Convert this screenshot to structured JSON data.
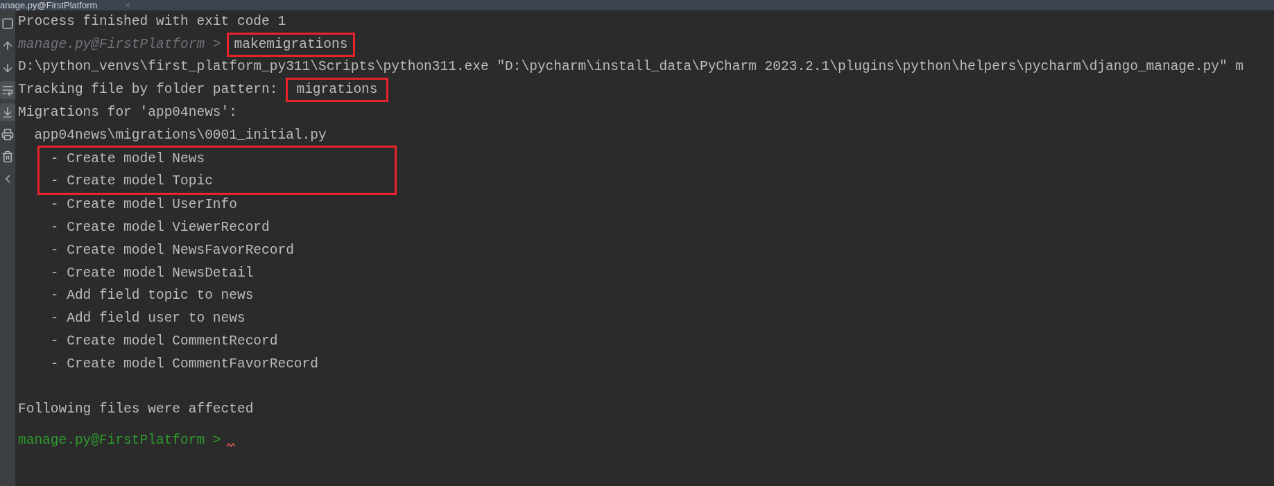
{
  "tab": {
    "title": "anage.py@FirstPlatform",
    "close": "×"
  },
  "toolbar": [
    {
      "kind": "stop",
      "selected": false
    },
    {
      "kind": "up",
      "selected": false
    },
    {
      "kind": "down",
      "selected": false
    },
    {
      "kind": "wrap",
      "selected": true
    },
    {
      "kind": "scroll-end",
      "selected": true
    },
    {
      "kind": "print",
      "selected": false
    },
    {
      "kind": "trash",
      "selected": false
    },
    {
      "kind": "collapse",
      "selected": false
    }
  ],
  "console": [
    {
      "kind": "output",
      "text": "Process finished with exit code 1"
    },
    {
      "kind": "prompt",
      "prompt": "manage.py@FirstPlatform >",
      "command": "makemigrations",
      "highlighted": true,
      "active": false
    },
    {
      "kind": "output",
      "text": "D:\\python_venvs\\first_platform_py311\\Scripts\\python311.exe \"D:\\pycharm\\install_data\\PyCharm 2023.2.1\\plugins\\python\\helpers\\pycharm\\django_manage.py\" m"
    },
    {
      "kind": "labeled",
      "text": "Tracking file by folder pattern:",
      "value": "migrations",
      "highlighted": true
    },
    {
      "kind": "output",
      "text": "Migrations for 'app04news':"
    },
    {
      "kind": "output",
      "text": "  app04news\\migrations\\0001_initial.py"
    },
    {
      "kind": "group",
      "highlighted": true,
      "lines": [
        "    - Create model News",
        "    - Create model Topic"
      ]
    },
    {
      "kind": "output",
      "text": "    - Create model UserInfo"
    },
    {
      "kind": "output",
      "text": "    - Create model ViewerRecord"
    },
    {
      "kind": "output",
      "text": "    - Create model NewsFavorRecord"
    },
    {
      "kind": "output",
      "text": "    - Create model NewsDetail"
    },
    {
      "kind": "output",
      "text": "    - Add field topic to news"
    },
    {
      "kind": "output",
      "text": "    - Add field user to news"
    },
    {
      "kind": "output",
      "text": "    - Create model CommentRecord"
    },
    {
      "kind": "output",
      "text": "    - Create model CommentFavorRecord"
    },
    {
      "kind": "blank"
    },
    {
      "kind": "output",
      "text": "Following files were affected"
    },
    {
      "kind": "gap"
    },
    {
      "kind": "prompt",
      "prompt": "manage.py@FirstPlatform >",
      "active": true
    }
  ]
}
